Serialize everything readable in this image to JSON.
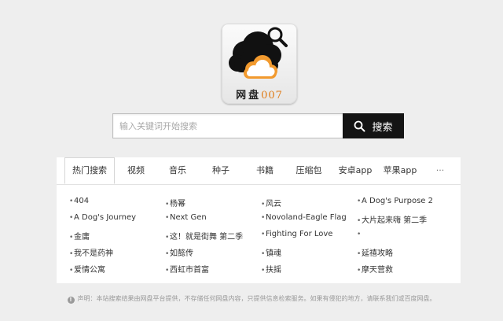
{
  "logo": {
    "brand_text": "网盘",
    "brand_number": "007",
    "icon": "cloud-magnifier-logo"
  },
  "search": {
    "placeholder": "输入关键词开始搜索",
    "value": "",
    "button_label": "搜索",
    "button_icon": "search-icon"
  },
  "tabs": [
    {
      "label": "热门搜索",
      "active": true
    },
    {
      "label": "视频",
      "active": false
    },
    {
      "label": "音乐",
      "active": false
    },
    {
      "label": "种子",
      "active": false
    },
    {
      "label": "书籍",
      "active": false
    },
    {
      "label": "压缩包",
      "active": false
    },
    {
      "label": "安卓app",
      "active": false
    },
    {
      "label": "苹果app",
      "active": false
    },
    {
      "label": "···",
      "active": false
    }
  ],
  "hot_searches": {
    "columns": [
      [
        "404",
        "A Dog's Journey",
        "金庸",
        "我不是药神",
        "爱情公寓"
      ],
      [
        "杨幂",
        "Next Gen",
        "这！就是街舞 第二季",
        "如懿传",
        "西虹市首富"
      ],
      [
        "风云",
        "Novoland-Eagle Flag",
        "Fighting For Love",
        "镇魂",
        "扶摇"
      ],
      [
        "A Dog's Purpose 2",
        "大片起来嗨 第二季",
        "",
        "延禧攻略",
        "摩天营救"
      ]
    ]
  },
  "footer": {
    "icon": "info-icon",
    "text": "声明：本站搜索结果由网盘平台提供，不存储任何网盘内容，只提供信息检索服务。如果有侵犯的地方，请联系我们或百度网盘。"
  },
  "colors": {
    "background": "#eeeeee",
    "search_button": "#141414",
    "brand_number": "#e07b16",
    "cloud_orange": "#f29a2e"
  }
}
